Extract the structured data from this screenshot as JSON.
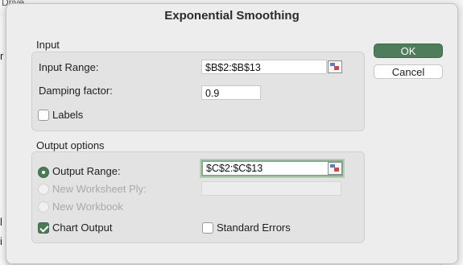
{
  "background": {
    "top_text": "Drive",
    "left_fragments": [
      "r",
      "l",
      "i"
    ]
  },
  "dialog": {
    "title": "Exponential Smoothing",
    "buttons": {
      "ok": "OK",
      "cancel": "Cancel"
    },
    "input": {
      "section_title": "Input",
      "input_range_label": "Input Range:",
      "input_range_value": "$B$2:$B$13",
      "damping_label": "Damping factor:",
      "damping_value": "0.9",
      "labels_label": "Labels",
      "labels_checked": false
    },
    "output": {
      "section_title": "Output options",
      "output_range_label": "Output Range:",
      "output_range_value": "$C$2:$C$13",
      "new_worksheet_label": "New Worksheet Ply:",
      "new_workbook_label": "New Workbook",
      "chart_output_label": "Chart Output",
      "chart_output_checked": true,
      "standard_errors_label": "Standard Errors",
      "standard_errors_checked": false,
      "selected_option": "Output Range"
    }
  },
  "colors": {
    "accent": "#4f7c5a",
    "focus_ring": "#86a98e"
  }
}
